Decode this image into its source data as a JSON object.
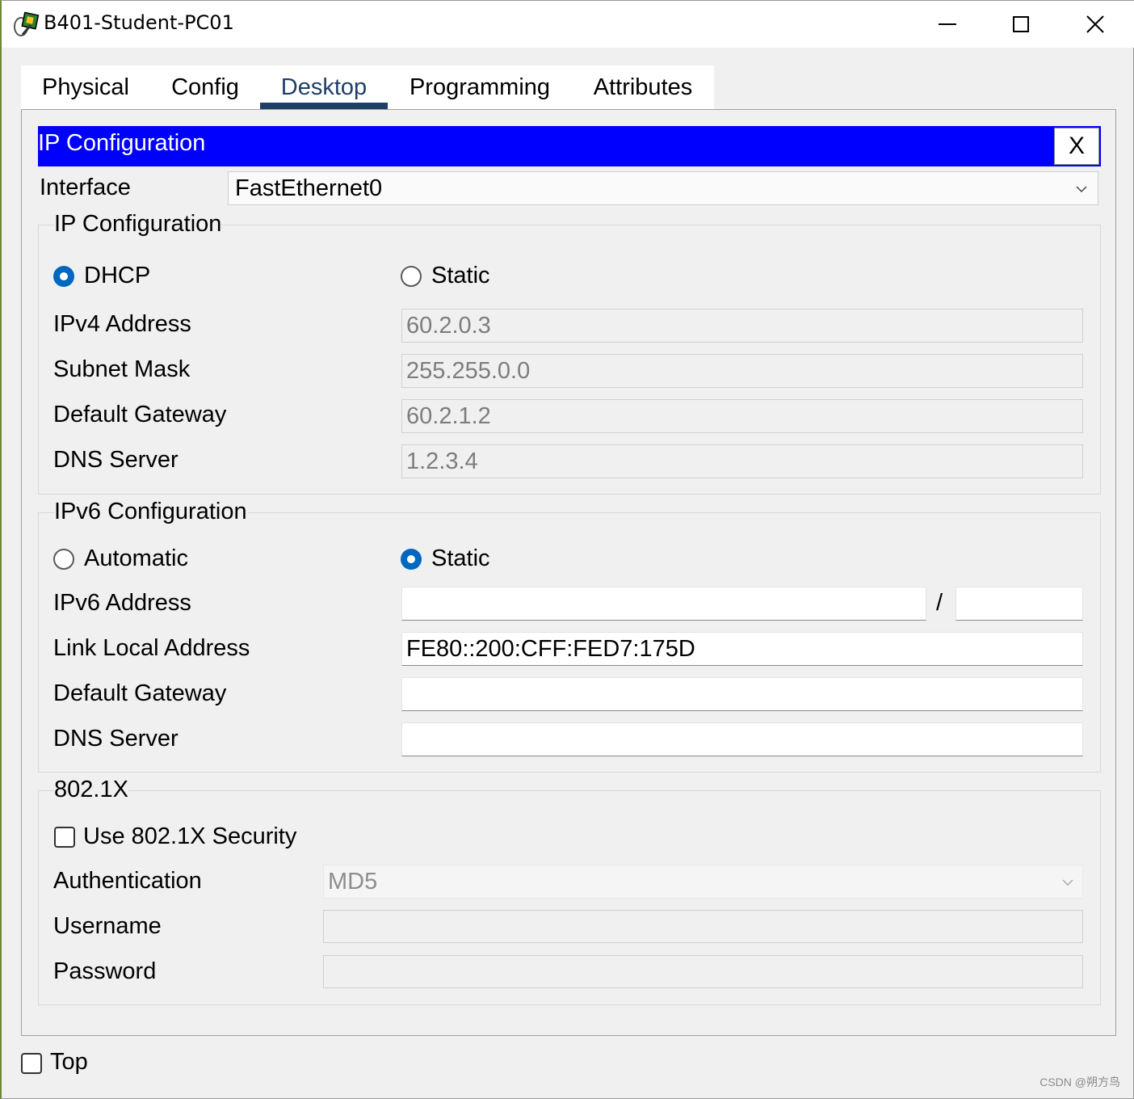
{
  "window": {
    "title": "B401-Student-PC01"
  },
  "tabs": [
    "Physical",
    "Config",
    "Desktop",
    "Programming",
    "Attributes"
  ],
  "active_tab": "Desktop",
  "panel": {
    "title": "IP Configuration",
    "close_label": "X"
  },
  "interface": {
    "label": "Interface",
    "value": "FastEthernet0"
  },
  "ipv4": {
    "group_title": "IP Configuration",
    "dhcp_label": "DHCP",
    "static_label": "Static",
    "mode": "DHCP",
    "fields": [
      {
        "label": "IPv4 Address",
        "value": "60.2.0.3"
      },
      {
        "label": "Subnet Mask",
        "value": "255.255.0.0"
      },
      {
        "label": "Default Gateway",
        "value": "60.2.1.2"
      },
      {
        "label": "DNS Server",
        "value": "1.2.3.4"
      }
    ]
  },
  "ipv6": {
    "group_title": "IPv6 Configuration",
    "automatic_label": "Automatic",
    "static_label": "Static",
    "mode": "Static",
    "address_label": "IPv6 Address",
    "address_value": "",
    "prefix_separator": "/",
    "prefix_value": "",
    "link_local_label": "Link Local Address",
    "link_local_value": "FE80::200:CFF:FED7:175D",
    "gateway_label": "Default Gateway",
    "gateway_value": "",
    "dns_label": "DNS Server",
    "dns_value": ""
  },
  "dot1x": {
    "group_title": "802.1X",
    "use_security_label": "Use 802.1X Security",
    "use_security_checked": false,
    "auth_label": "Authentication",
    "auth_value": "MD5",
    "username_label": "Username",
    "username_value": "",
    "password_label": "Password",
    "password_value": ""
  },
  "footer": {
    "top_label": "Top",
    "top_checked": false
  },
  "watermark": "CSDN @朔方鸟",
  "colors": {
    "header_blue": "#0000ff",
    "accent": "#0067c0",
    "tab_active": "#1e3f66"
  }
}
